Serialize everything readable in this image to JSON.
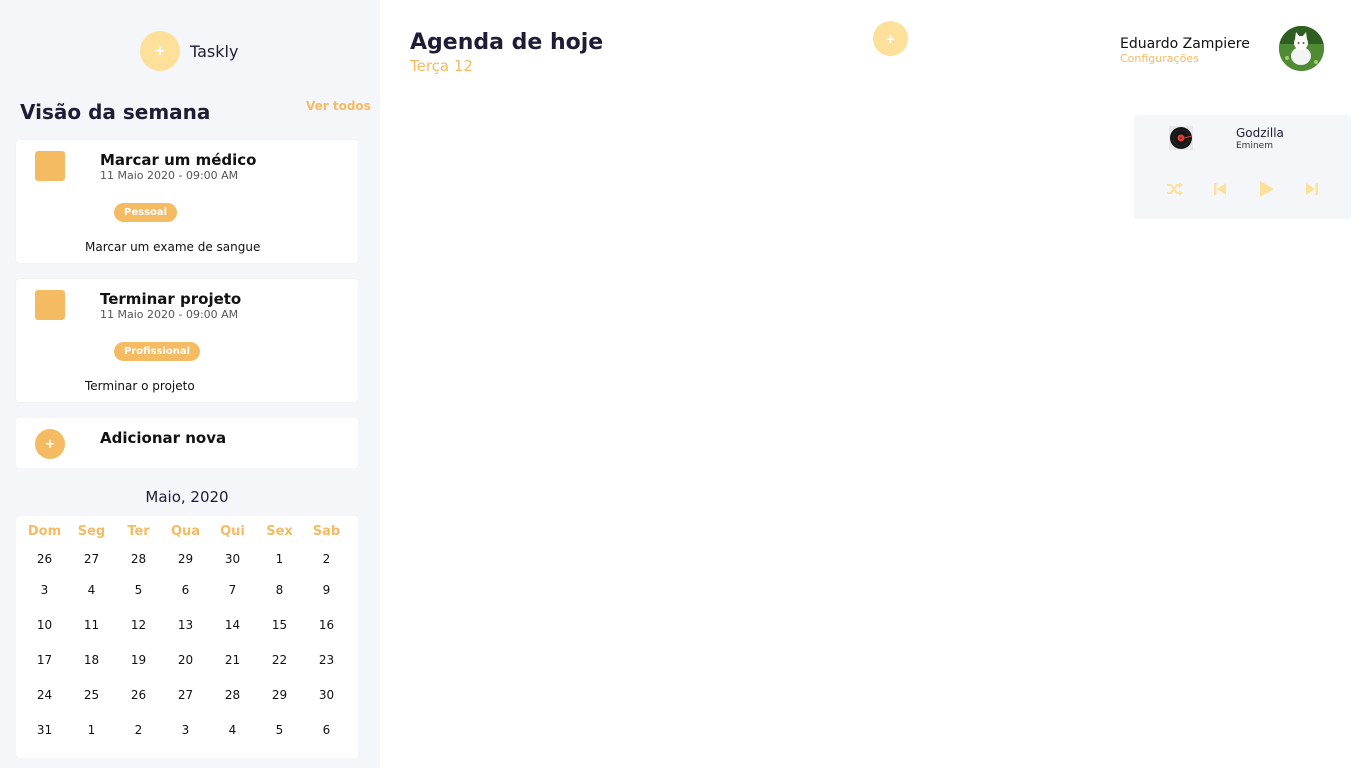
{
  "sidebar": {
    "logo_symbol": "+",
    "app_name": "Taskly",
    "week_title": "Visão da semana",
    "see_all": "Ver todos",
    "tasks": [
      {
        "title": "Marcar um médico",
        "date": "11 Maio 2020 - 09:00 AM",
        "tag": "Pessoal",
        "description": "Marcar um exame de sangue"
      },
      {
        "title": "Terminar projeto",
        "date": "11 Maio 2020 - 09:00 AM",
        "tag": "Profissional",
        "description": "Terminar o projeto"
      }
    ],
    "add_new": {
      "symbol": "+",
      "label": "Adicionar nova"
    }
  },
  "calendar": {
    "title": "Maio, 2020",
    "weekdays": [
      "Dom",
      "Seg",
      "Ter",
      "Qua",
      "Qui",
      "Sex",
      "Sab"
    ],
    "days": [
      "26",
      "27",
      "28",
      "29",
      "30",
      "1",
      "2",
      "3",
      "4",
      "5",
      "6",
      "7",
      "8",
      "9",
      "10",
      "11",
      "12",
      "13",
      "14",
      "15",
      "16",
      "17",
      "18",
      "19",
      "20",
      "21",
      "22",
      "23",
      "24",
      "25",
      "26",
      "27",
      "28",
      "29",
      "30",
      "31",
      "1",
      "2",
      "3",
      "4",
      "5",
      "6"
    ]
  },
  "main": {
    "title": "Agenda de hoje",
    "subtitle": "Terça 12",
    "add_symbol": "+"
  },
  "user": {
    "name": "Eduardo Zampiere",
    "settings_label": "Configurações",
    "avatar_icon": "cat-photo-avatar"
  },
  "player": {
    "song": "Godzilla",
    "artist": "Eminem",
    "icons": [
      "vinyl-icon",
      "shuffle-icon",
      "previous-icon",
      "play-icon",
      "next-icon"
    ]
  },
  "colors": {
    "accent": "#f5bb62",
    "accent_light": "#fde09a",
    "sidebar_bg": "#f5f6fa",
    "text_dark": "#1f1d36"
  }
}
